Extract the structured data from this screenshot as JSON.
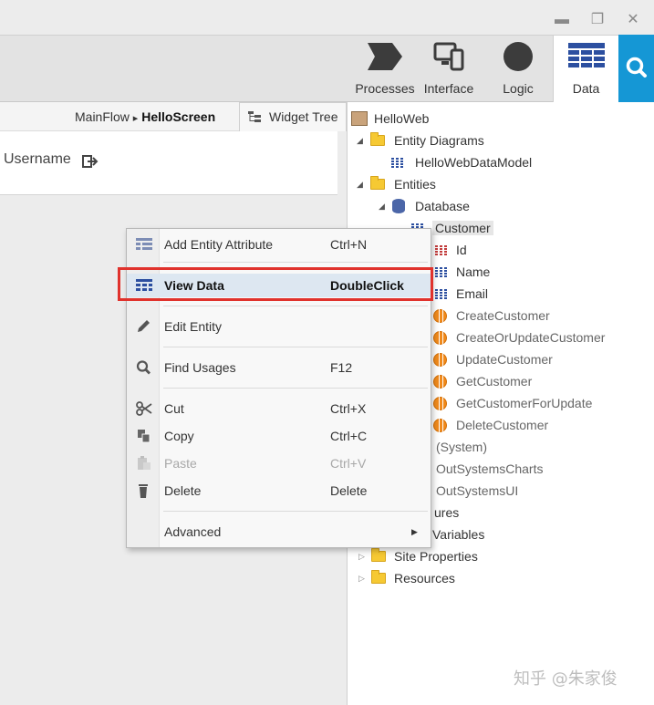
{
  "window": {
    "minimize_glyph": "▬",
    "restore_glyph": "❐",
    "close_glyph": "✕"
  },
  "toolbar": {
    "tabs": [
      {
        "label": "Processes",
        "icon": "processes-chevron-icon"
      },
      {
        "label": "Interface",
        "icon": "devices-icon"
      },
      {
        "label": "Logic",
        "icon": "logic-circle-icon"
      },
      {
        "label": "Data",
        "icon": "data-grid-icon",
        "active": true
      }
    ],
    "search_icon": "search-icon",
    "accent_color": "#1597d5"
  },
  "breadcrumb": {
    "flow": "MainFlow",
    "separator": "▸",
    "screen": "HelloScreen"
  },
  "canvas": {
    "username_label": "Username"
  },
  "widget_tree_tab": {
    "label": "Widget Tree"
  },
  "tree": {
    "root": "HelloWeb",
    "entity_diagrams": "Entity Diagrams",
    "data_model": "HelloWebDataModel",
    "entities": "Entities",
    "database": "Database",
    "customer": "Customer",
    "attributes": [
      "Id",
      "Name",
      "Email"
    ],
    "actions": [
      "CreateCustomer",
      "CreateOrUpdateCustomer",
      "UpdateCustomer",
      "GetCustomer",
      "GetCustomerForUpdate",
      "DeleteCustomer"
    ],
    "system": "(System)",
    "charts": "OutSystemsCharts",
    "ui": "OutSystemsUI",
    "structures_partial": "ures",
    "variables_partial": "Variables",
    "site_properties": "Site Properties",
    "resources": "Resources"
  },
  "context_menu": {
    "items": [
      {
        "label": "Add Entity Attribute",
        "shortcut": "Ctrl+N"
      },
      {
        "label": "View Data",
        "shortcut": "DoubleClick"
      },
      {
        "label": "Edit Entity",
        "shortcut": ""
      },
      {
        "label": "Find Usages",
        "shortcut": "F12"
      },
      {
        "label": "Cut",
        "shortcut": "Ctrl+X"
      },
      {
        "label": "Copy",
        "shortcut": "Ctrl+C"
      },
      {
        "label": "Paste",
        "shortcut": "Ctrl+V"
      },
      {
        "label": "Delete",
        "shortcut": "Delete"
      },
      {
        "label": "Advanced",
        "shortcut": ""
      }
    ],
    "highlight_color": "#e0322c"
  },
  "watermark": "知乎 @朱家俊"
}
